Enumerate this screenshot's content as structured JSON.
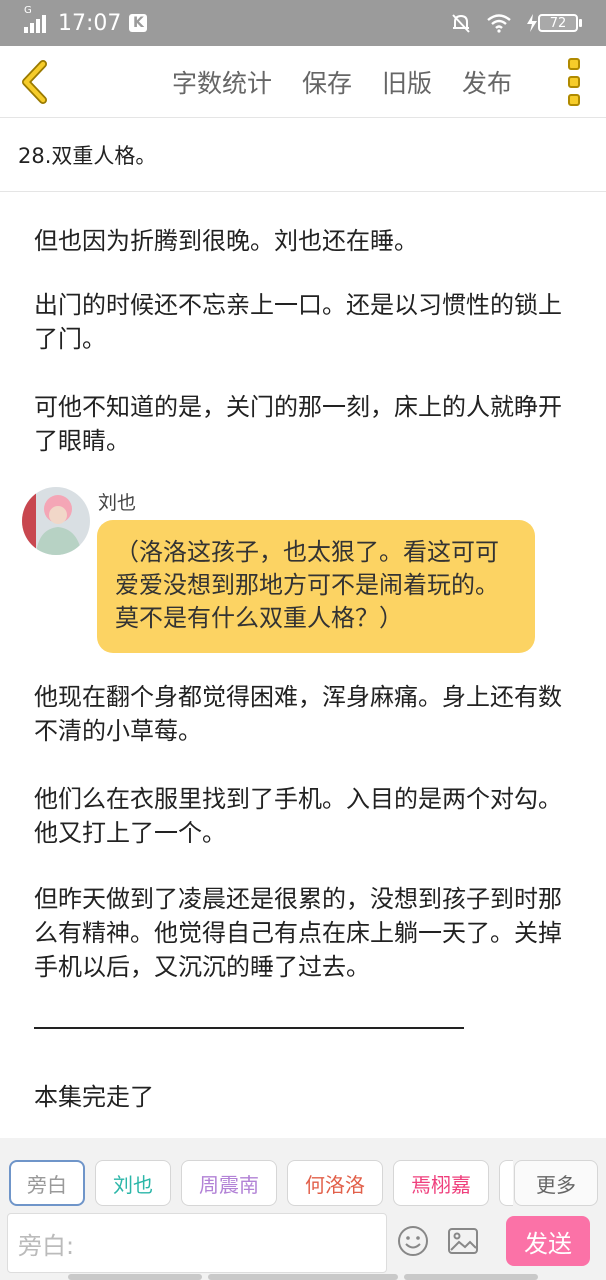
{
  "status_bar": {
    "network_type": "G",
    "time": "17:07",
    "notification_badge": "K",
    "battery_level": "72"
  },
  "toolbar": {
    "word_count_label": "字数统计",
    "save_label": "保存",
    "old_version_label": "旧版",
    "publish_label": "发布"
  },
  "chapter": {
    "title": "28.双重人格。"
  },
  "content": {
    "paragraphs": [
      "但也因为折腾到很晚。刘也还在睡。",
      "出门的时候还不忘亲上一口。还是以习惯性的锁上了门。",
      "可他不知道的是，关门的那一刻，床上的人就睁开了眼睛。",
      "他现在翻个身都觉得困难，浑身麻痛。身上还有数不清的小草莓。",
      "他们么在衣服里找到了手机。入目的是两个对勾。他又打上了一个。",
      "但昨天做到了凌晨还是很累的，没想到孩子到时那么有精神。他觉得自己有点在床上躺一天了。关掉手机以后，又沉沉的睡了过去。",
      "本集完走了"
    ],
    "dialogue": {
      "speaker": "刘也",
      "text": "（洛洛这孩子，也太狠了。看这可可爱爱没想到那地方可不是闹着玩的。莫不是有什么双重人格？）"
    }
  },
  "composer": {
    "roles": [
      {
        "label": "旁白",
        "color": "#9a9a9a"
      },
      {
        "label": "刘也",
        "color": "#2bb6a8"
      },
      {
        "label": "周震南",
        "color": "#b282d6"
      },
      {
        "label": "何洛洛",
        "color": "#e2604a"
      },
      {
        "label": "焉栩嘉",
        "color": "#ef3f7c"
      }
    ],
    "more_label": "更多",
    "input_placeholder": "旁白:",
    "send_label": "发送",
    "colors": {
      "send_button": "#fb72a7",
      "bubble": "#fcd363",
      "active_chip_border": "#6f95c9"
    }
  }
}
